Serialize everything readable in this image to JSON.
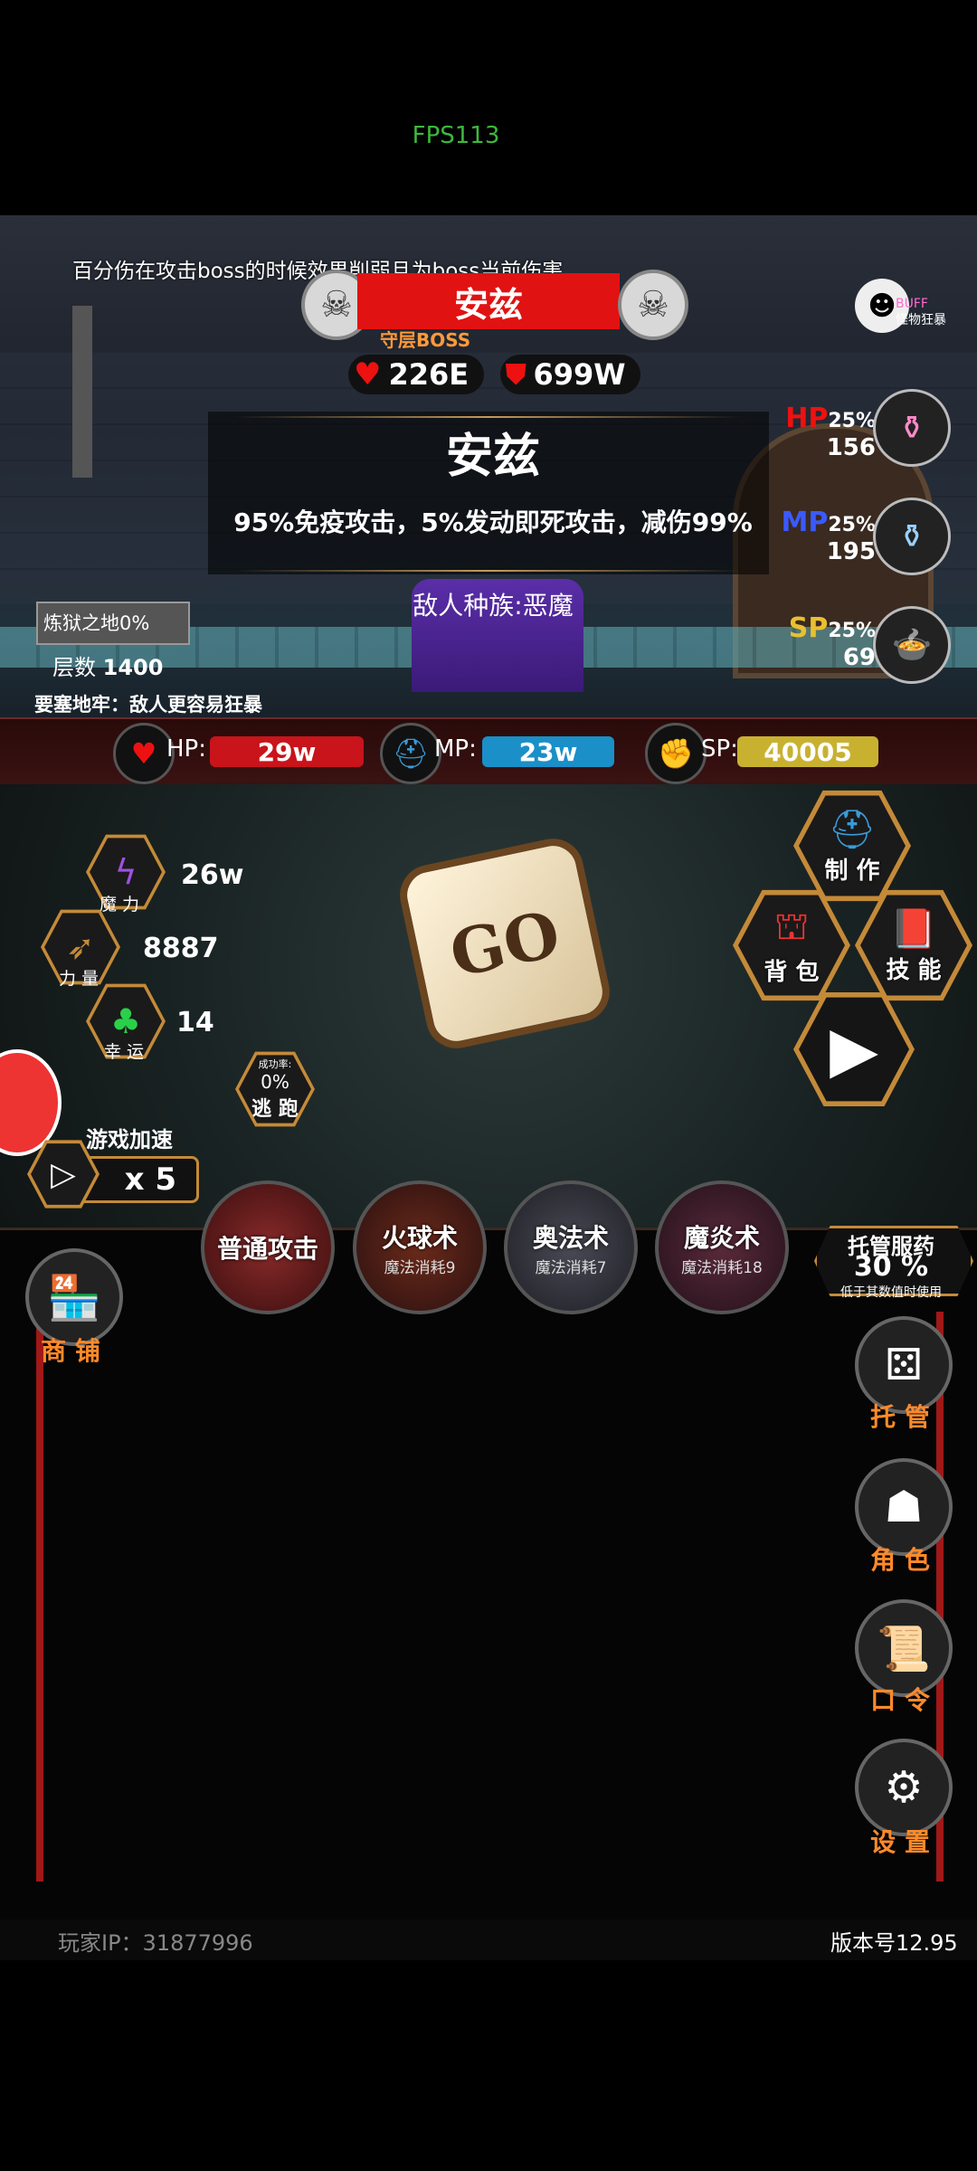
{
  "overlay": {
    "fps": "FPS113"
  },
  "hint_text": "百分伤在攻击boss的时候效果削弱且为boss当前伤害",
  "boss": {
    "name_bar": "安兹",
    "guard_label": "守层BOSS",
    "hp_value": "226E",
    "def_value": "699W",
    "name_title": "安兹",
    "description": "95%免疫攻击，5%发动即死攻击，减伤99%",
    "race": "敌人种族:恶魔",
    "buff_label": "BUFF",
    "buff_sub": "怪物狂暴"
  },
  "location": {
    "name": "炼狱之地0%",
    "floor_label": "层数",
    "floor_value": "1400",
    "fortress": "要塞地牢：敌人更容易狂暴"
  },
  "potions": {
    "hp": {
      "label": "HP",
      "pct": "25%",
      "count": "156"
    },
    "mp": {
      "label": "MP",
      "pct": "25%",
      "count": "195"
    },
    "sp": {
      "label": "SP",
      "pct": "25%",
      "count": "69"
    }
  },
  "bars": {
    "hp_label": "HP:",
    "hp_value": "29w",
    "mp_label": "MP:",
    "mp_value": "23w",
    "sp_label": "SP:",
    "sp_value": "40005"
  },
  "stats": {
    "magic_value": "26w",
    "magic_label": "魔 力",
    "power_value": "8887",
    "power_label": "力 量",
    "luck_value": "14",
    "luck_label": "幸 运"
  },
  "escape": {
    "rate_label": "成功率:",
    "rate": "0%",
    "label": "逃 跑"
  },
  "speed": {
    "title": "游戏加速",
    "value": "x 5"
  },
  "dice_text": "GO",
  "actions": {
    "craft": "制 作",
    "bag": "背 包",
    "skill": "技 能"
  },
  "skills": [
    {
      "name": "普通攻击",
      "cost": ""
    },
    {
      "name": "火球术",
      "cost": "魔法消耗9"
    },
    {
      "name": "奥法术",
      "cost": "魔法消耗7"
    },
    {
      "name": "魔炎术",
      "cost": "魔法消耗18"
    }
  ],
  "auto_medicine": {
    "title": "托管服药",
    "value": "30 %",
    "sub": "低于其数值时使用"
  },
  "side_menu": {
    "shop": "商 铺",
    "auto": "托 管",
    "role": "角 色",
    "password": "口 令",
    "settings": "设 置"
  },
  "footer": {
    "player_ip": "玩家IP：31877996",
    "version": "版本号12.95"
  },
  "colors": {
    "hp_red": "#c8141a",
    "mp_blue": "#1a8fc8",
    "sp_gold": "#c9b130",
    "accent_orange": "#ff8a2a",
    "hex_border": "#c48a38"
  }
}
